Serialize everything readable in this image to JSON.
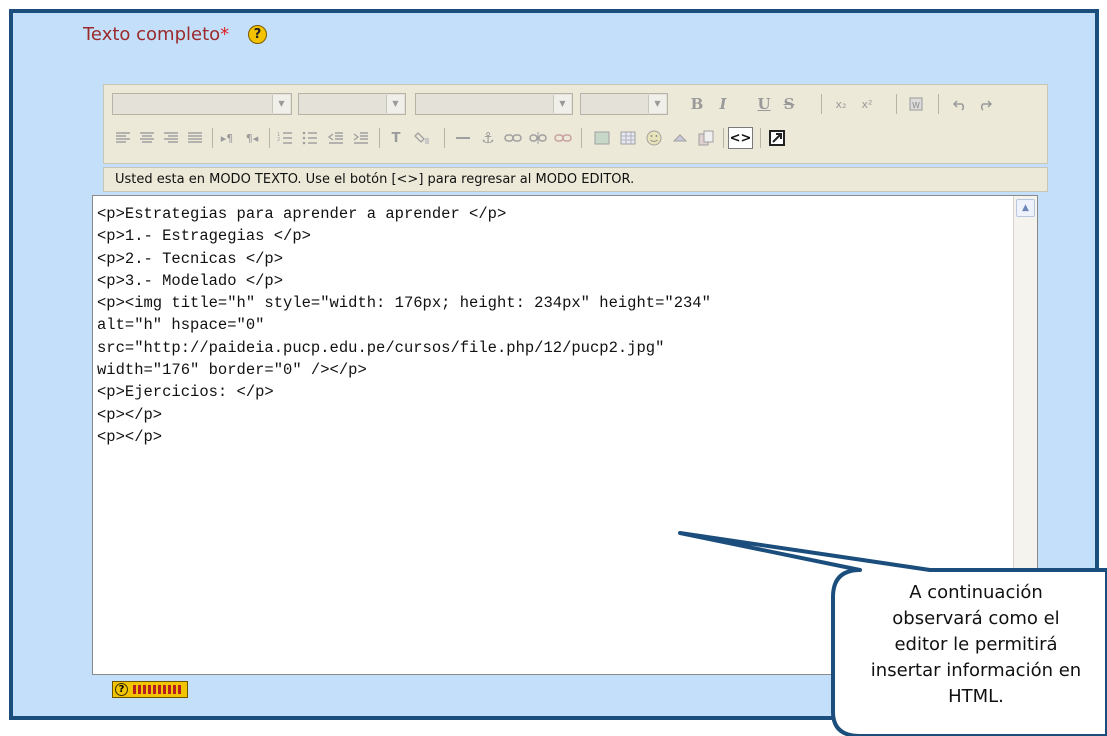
{
  "field": {
    "label": "Texto completo",
    "required_mark": "*",
    "help_icon": "help-icon"
  },
  "toolbar": {
    "row1": {
      "dropdowns": [
        "font-family",
        "font-size",
        "paragraph-format",
        "language"
      ],
      "buttons": [
        "B",
        "I",
        "U",
        "S",
        "x₂",
        "x²",
        "paste-word-icon",
        "undo-icon",
        "redo-icon"
      ]
    },
    "row2": {
      "buttons": [
        "justify-left-icon",
        "justify-center-icon",
        "justify-right-icon",
        "justify-full-icon",
        "ltr-icon",
        "rtl-icon",
        "ordered-list-icon",
        "unordered-list-icon",
        "outdent-icon",
        "indent-icon",
        "text-color-icon",
        "background-color-icon",
        "horizontal-rule-icon",
        "anchor-icon",
        "link-icon",
        "unlink-icon",
        "nolink-icon",
        "insert-image-icon",
        "insert-table-icon",
        "smiley-icon",
        "special-char-icon",
        "search-replace-icon"
      ],
      "html_mode_label": "<>",
      "fullscreen_icon": "fullscreen-icon"
    }
  },
  "status_bar": {
    "text": "Usted esta en MODO TEXTO. Use el botón [<>] para regresar al MODO EDITOR."
  },
  "editor": {
    "code": "<p>Estrategias para aprender a aprender </p>\n<p>1.- Estragegias </p>\n<p>2.- Tecnicas </p>\n<p>3.- Modelado </p>\n<p><img title=\"h\" style=\"width: 176px; height: 234px\" height=\"234\"\nalt=\"h\" hspace=\"0\"\nsrc=\"http://paideia.pucp.edu.pe/cursos/file.php/12/pucp2.jpg\"\nwidth=\"176\" border=\"0\" /></p>\n<p>Ejercicios: </p>\n<p></p>\n<p></p>"
  },
  "footer": {
    "keyboard_help_icon": "keyboard-help-icon"
  },
  "callout": {
    "lines": [
      "A continuación",
      "observará como el",
      "editor le permitirá",
      "insertar información en",
      "HTML."
    ]
  },
  "colors": {
    "frame_border": "#1b4e7c",
    "frame_bg": "#c3dffa",
    "label_color": "#9b2a2a",
    "toolbar_bg": "#ece9d8"
  }
}
